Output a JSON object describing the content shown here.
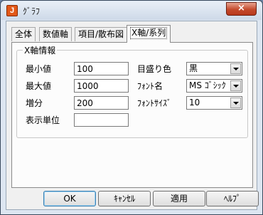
{
  "window": {
    "title": "ｸﾞﾗﾌ",
    "icon_letter": "J",
    "close_glyph": "×"
  },
  "tabs": [
    "全体",
    "数値軸",
    "項目/散布図",
    "X軸/系列"
  ],
  "active_tab": "X軸/系列",
  "group": {
    "title": "X軸情報",
    "min_label": "最小値",
    "min_value": "100",
    "max_label": "最大値",
    "max_value": "1000",
    "step_label": "増分",
    "step_value": "200",
    "unit_label": "表示単位",
    "unit_value": "",
    "grid_color_label": "目盛り色",
    "grid_color_value": "黒",
    "font_name_label": "ﾌｫﾝﾄ名",
    "font_name_value": "MS ｺﾞｼｯｸ",
    "font_size_label": "ﾌｫﾝﾄｻｲｽﾞ",
    "font_size_value": "10"
  },
  "buttons": {
    "ok": "OK",
    "cancel": "ｷｬﾝｾﾙ",
    "apply": "適用",
    "help": "ﾍﾙﾌﾟ"
  }
}
